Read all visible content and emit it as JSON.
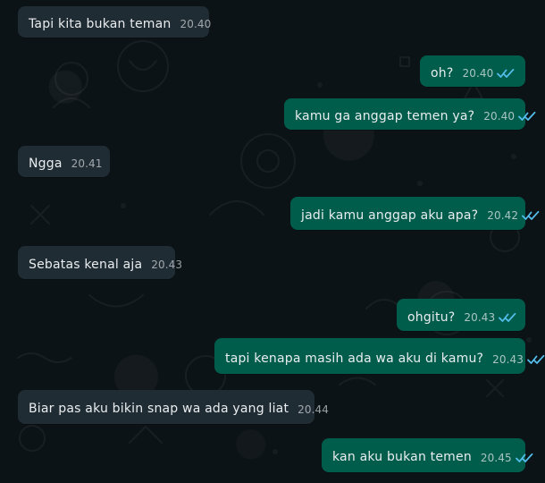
{
  "chat": {
    "messages": [
      {
        "direction": "incoming",
        "text": "Tapi kita bukan teman",
        "time": "20.40"
      },
      {
        "direction": "outgoing",
        "text": "oh?",
        "time": "20.40",
        "status_icon": "read-ticks"
      },
      {
        "direction": "outgoing",
        "text": "kamu ga anggap temen ya?",
        "time": "20.40",
        "status_icon": "read-ticks"
      },
      {
        "direction": "incoming",
        "text": "Ngga",
        "time": "20.41"
      },
      {
        "direction": "outgoing",
        "text": "jadi kamu anggap aku apa?",
        "time": "20.42",
        "status_icon": "read-ticks"
      },
      {
        "direction": "incoming",
        "text": "Sebatas kenal aja",
        "time": "20.43"
      },
      {
        "direction": "outgoing",
        "text": "ohgitu?",
        "time": "20.43",
        "status_icon": "read-ticks"
      },
      {
        "direction": "outgoing",
        "text": "tapi kenapa masih ada wa aku di kamu?",
        "time": "20.43",
        "status_icon": "read-ticks"
      },
      {
        "direction": "incoming",
        "text": "Biar pas aku bikin snap wa ada yang liat",
        "time": "20.44"
      },
      {
        "direction": "outgoing",
        "text": "kan aku bukan temen",
        "time": "20.45",
        "status_icon": "read-ticks"
      }
    ]
  },
  "colors": {
    "background": "#0c1317",
    "incoming_bubble": "#202c33",
    "outgoing_bubble": "#005c4b",
    "text": "#e9edef",
    "read_tick": "#53bdeb"
  }
}
